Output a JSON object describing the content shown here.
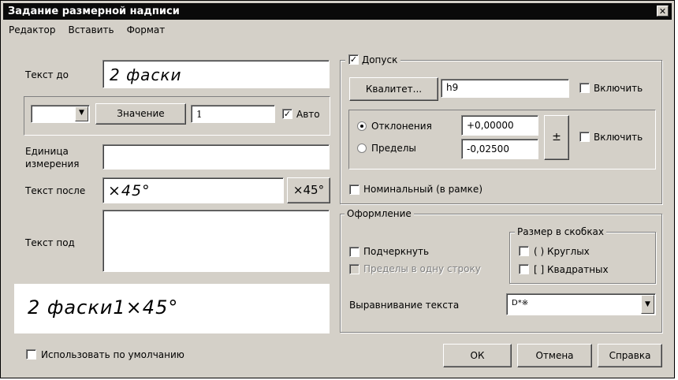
{
  "window": {
    "title": "Задание размерной надписи",
    "close_glyph": "✕"
  },
  "menu": [
    {
      "label": "Редактор"
    },
    {
      "label": "Вставить"
    },
    {
      "label": "Формат"
    }
  ],
  "left": {
    "text_before_label": "Текст до",
    "text_before_value": "2 фаски",
    "value_button": "Значение",
    "value_field": "1",
    "auto_label": "Авто",
    "auto_checked": "✓",
    "unit_label_1": "Единица",
    "unit_label_2": "измерения",
    "unit_value": "",
    "text_after_label": "Текст после",
    "text_after_value": "×45°",
    "text_after_button": "×45°",
    "text_under_label": "Текст под",
    "text_under_value": "",
    "preview": "2 фаски1×45°",
    "use_default_label": "Использовать по умолчанию"
  },
  "tolerance": {
    "group_label": "Допуск",
    "group_checked": "✓",
    "qualitet_button": "Квалитет...",
    "qualitet_value": "h9",
    "include_label_1": "Включить",
    "deviations_label": "Отклонения",
    "limits_label": "Пределы",
    "upper_value": "+0,00000",
    "lower_value": "-0,02500",
    "plusminus": "±",
    "include_label_2": "Включить",
    "nominal_label": "Номинальный (в рамке)"
  },
  "formatting": {
    "group_label": "Оформление",
    "underline_label": "Подчеркнуть",
    "one_line_label": "Пределы в одну строку",
    "brackets_group": "Размер в скобках",
    "round_label": "( ) Круглых",
    "square_label": "[ ] Квадратных",
    "align_label": "Выравнивание текста",
    "align_value": "D*※"
  },
  "buttons": {
    "ok": "ОК",
    "cancel": "Отмена",
    "help": "Справка"
  }
}
